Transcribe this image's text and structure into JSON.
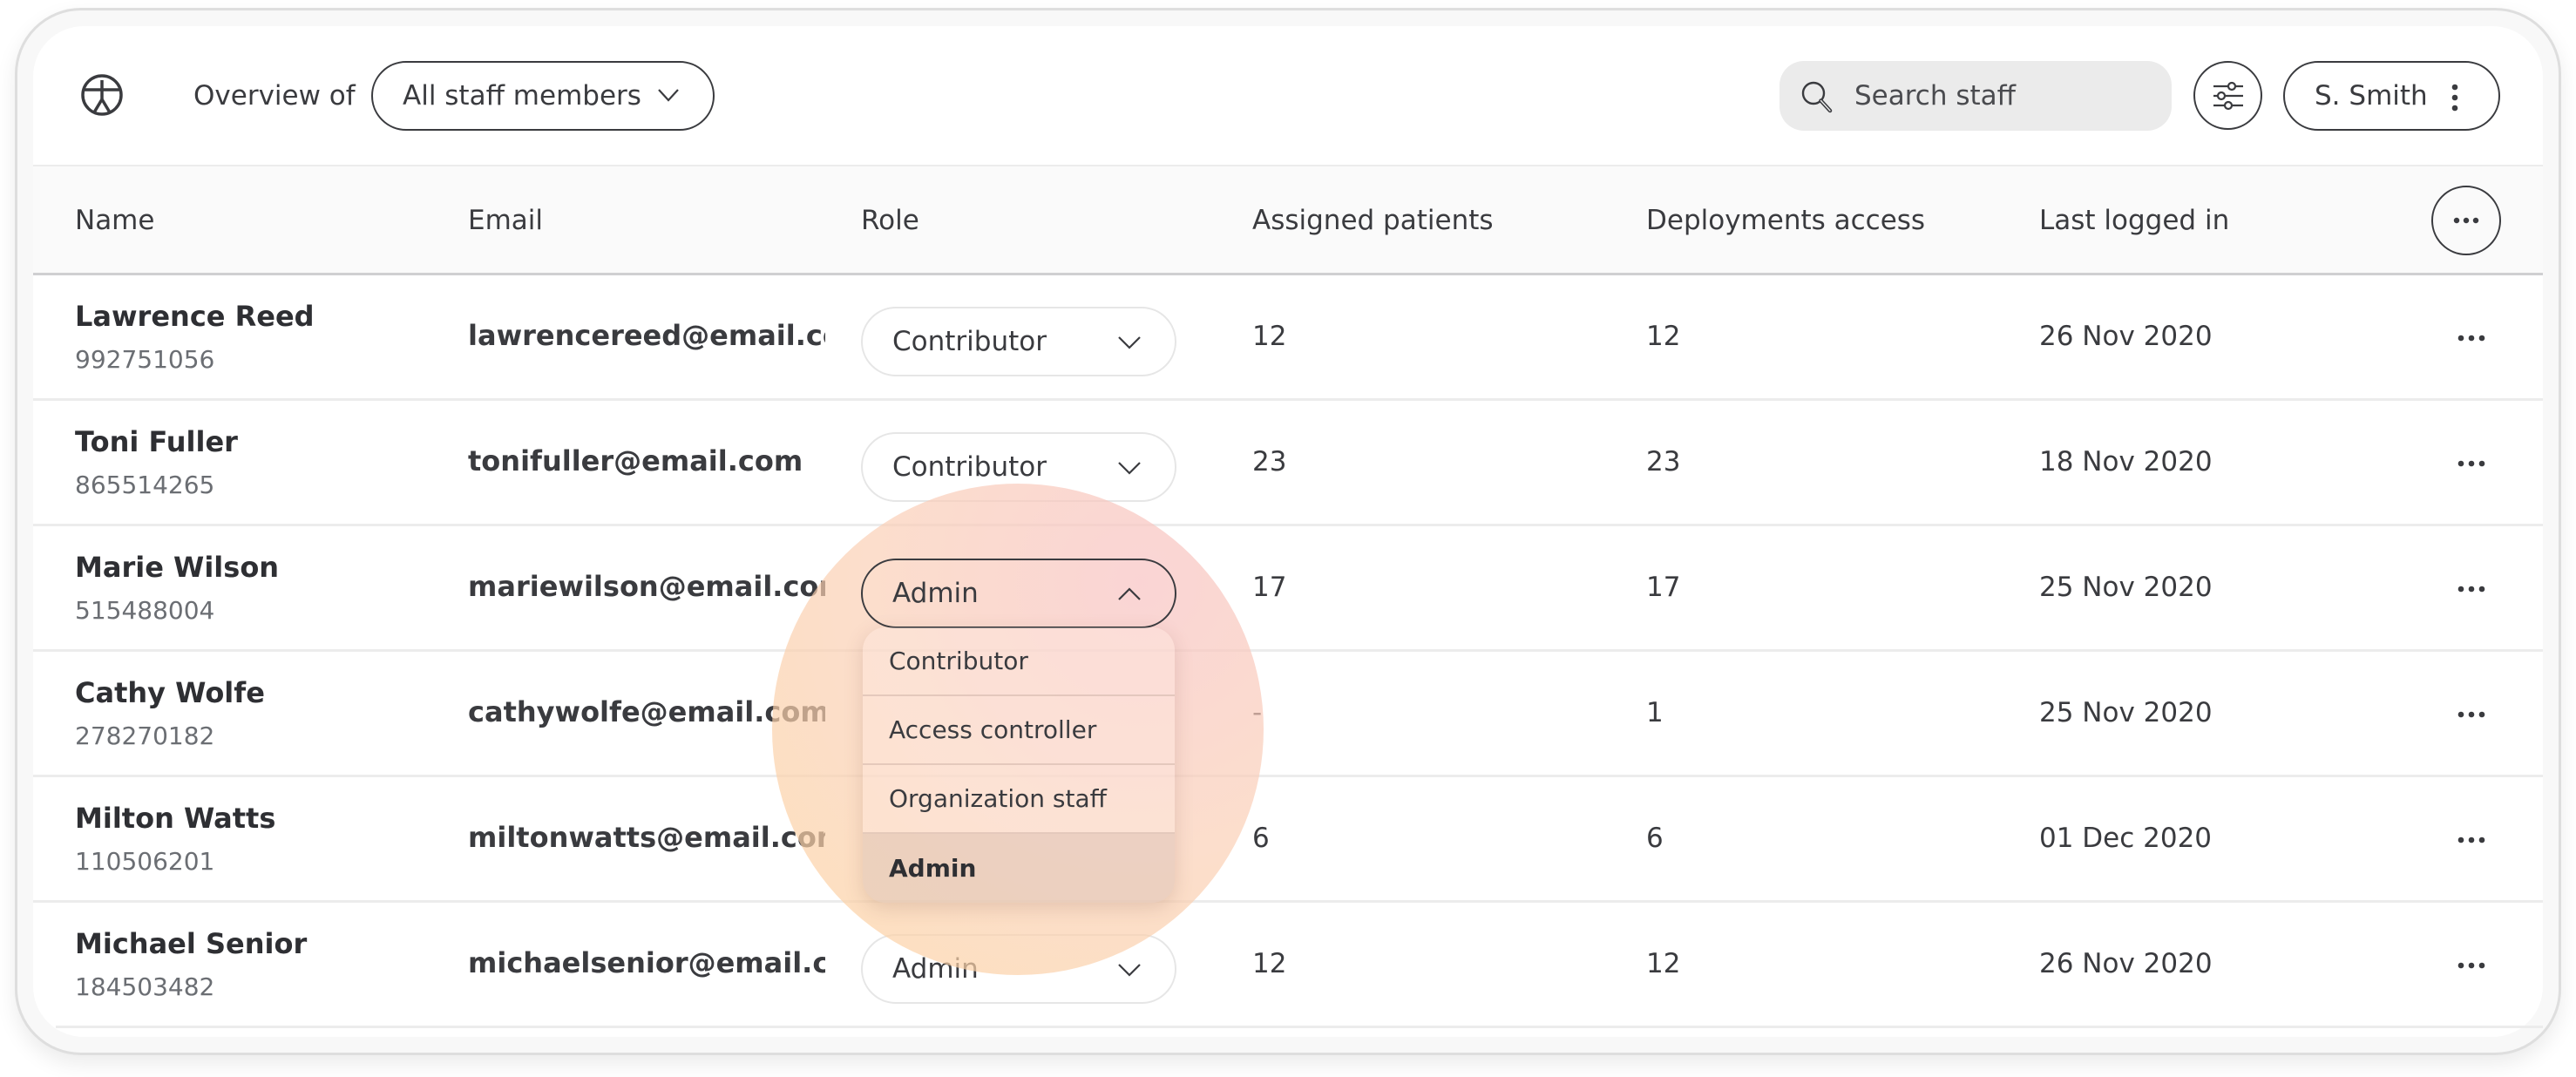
{
  "header": {
    "logo_icon": "person-in-circle-logo-icon",
    "overview_label": "Overview of",
    "staff_filter": {
      "selected": "All staff members",
      "icon": "chevron-down-icon"
    },
    "search": {
      "placeholder": "Search staff",
      "value": "",
      "icon": "search-icon"
    },
    "filter_button_icon": "sliders-icon",
    "user_menu": {
      "label": "S. Smith",
      "icon": "kebab-vertical-icon"
    }
  },
  "table": {
    "columns": [
      "Name",
      "Email",
      "Role",
      "Assigned patients",
      "Deployments access",
      "Last logged in"
    ],
    "header_more_icon": "more-horizontal-icon",
    "rows": [
      {
        "name": "Lawrence Reed",
        "id": "992751056",
        "email": "lawrencereed@email.com",
        "role": "Contributor",
        "assigned": "12",
        "deployments": "12",
        "last_logged": "26 Nov 2020"
      },
      {
        "name": "Toni Fuller",
        "id": "865514265",
        "email": "tonifuller@email.com",
        "role": "Contributor",
        "assigned": "23",
        "deployments": "23",
        "last_logged": "18 Nov 2020"
      },
      {
        "name": "Marie Wilson",
        "id": "515488004",
        "email": "mariewilson@email.com",
        "role": "Admin",
        "assigned": "17",
        "deployments": "17",
        "last_logged": "25 Nov 2020",
        "dropdown_open": true
      },
      {
        "name": "Cathy Wolfe",
        "id": "278270182",
        "email": "cathywolfe@email.com",
        "role": "",
        "assigned": "-",
        "deployments": "1",
        "last_logged": "25 Nov 2020"
      },
      {
        "name": "Milton Watts",
        "id": "110506201",
        "email": "miltonwatts@email.com",
        "role": "",
        "assigned": "6",
        "deployments": "6",
        "last_logged": "01 Dec 2020"
      },
      {
        "name": "Michael Senior",
        "id": "184503482",
        "email": "michaelsenior@email.com",
        "role": "Admin",
        "assigned": "12",
        "deployments": "12",
        "last_logged": "26 Nov 2020"
      }
    ]
  },
  "role_menu": {
    "options": [
      "Contributor",
      "Access controller",
      "Organization staff",
      "Admin"
    ],
    "selected": "Admin"
  },
  "colors": {
    "text_primary": "#2e2f33",
    "text_secondary": "#6b6e73",
    "border_dark": "#3a3b3f",
    "search_bg": "#ebebeb",
    "header_bg": "#fafafa",
    "highlight_pink": "#f8c4c4",
    "highlight_peach": "#fdd4a0"
  }
}
